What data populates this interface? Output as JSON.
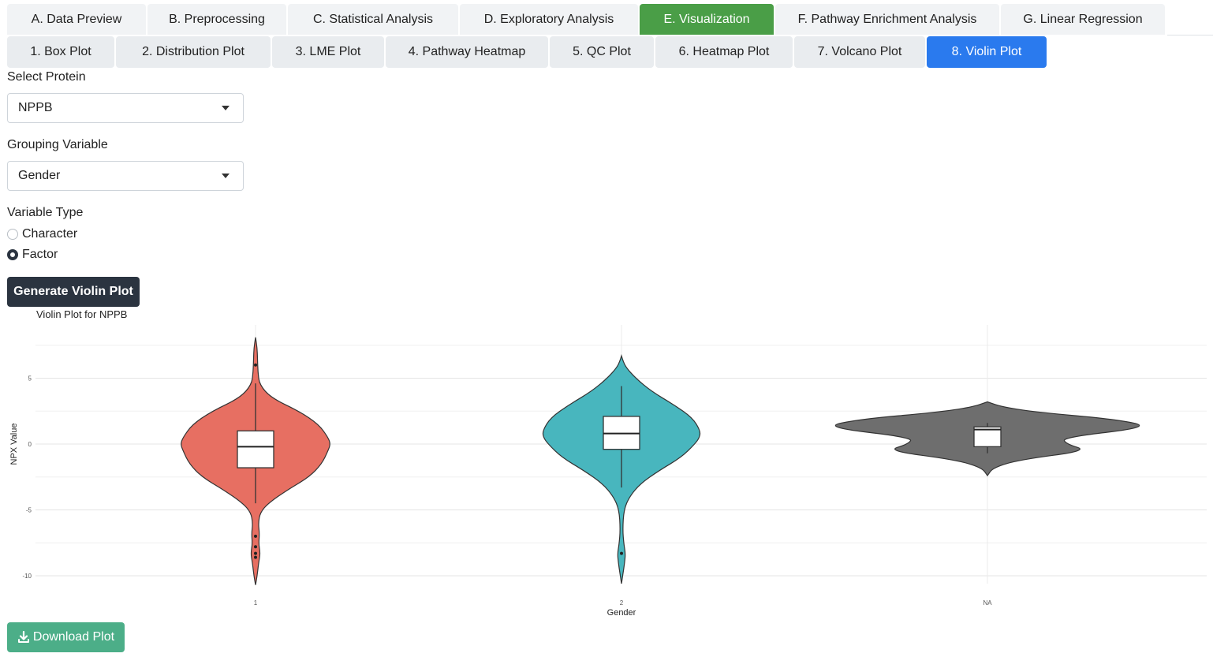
{
  "main_tabs": [
    {
      "label": "A. Data Preview",
      "active": false
    },
    {
      "label": "B. Preprocessing",
      "active": false
    },
    {
      "label": "C. Statistical Analysis",
      "active": false
    },
    {
      "label": "D. Exploratory Analysis",
      "active": false
    },
    {
      "label": "E. Visualization",
      "active": true
    },
    {
      "label": "F. Pathway Enrichment Analysis",
      "active": false
    },
    {
      "label": "G. Linear Regression",
      "active": false
    }
  ],
  "sub_tabs": [
    {
      "label": "1. Box Plot",
      "active": false
    },
    {
      "label": "2. Distribution Plot",
      "active": false
    },
    {
      "label": "3. LME Plot",
      "active": false
    },
    {
      "label": "4. Pathway Heatmap",
      "active": false
    },
    {
      "label": "5. QC Plot",
      "active": false
    },
    {
      "label": "6. Heatmap Plot",
      "active": false
    },
    {
      "label": "7. Volcano Plot",
      "active": false
    },
    {
      "label": "8. Violin Plot",
      "active": true
    }
  ],
  "form": {
    "protein_label": "Select Protein",
    "protein_value": "NPPB",
    "grouping_label": "Grouping Variable",
    "grouping_value": "Gender",
    "vartype_label": "Variable Type",
    "vartype_options": [
      {
        "label": "Character",
        "checked": false
      },
      {
        "label": "Factor",
        "checked": true
      }
    ],
    "generate_button": "Generate Violin Plot",
    "download_button": "Download Plot"
  },
  "colors": {
    "accent_green": "#4a9e47",
    "accent_blue": "#2a7aee",
    "dark": "#2b3440",
    "download": "#4cae88"
  },
  "chart_data": {
    "type": "violin",
    "title": "Violin Plot for NPPB",
    "xlabel": "Gender",
    "ylabel": "NPX Value",
    "categories": [
      "1",
      "2",
      "NA"
    ],
    "yticks": [
      5,
      0,
      -5,
      -10
    ],
    "ytick_labels": [
      "5",
      "0",
      "-5",
      "-10"
    ],
    "ylim": [
      -10.7,
      8.5
    ],
    "grid": true,
    "groups": [
      {
        "name": "1",
        "color": "#e76f62",
        "range": [
          -10.7,
          8.1
        ],
        "q1": -1.8,
        "median": -0.2,
        "q3": 1.0,
        "whisker_low": -4.5,
        "whisker_high": 4.6,
        "outliers": [
          6.0,
          -7.0,
          -7.8,
          -8.3,
          -8.6
        ]
      },
      {
        "name": "2",
        "color": "#48b6be",
        "range": [
          -10.6,
          6.7
        ],
        "q1": -0.4,
        "median": 0.8,
        "q3": 2.1,
        "whisker_low": -3.3,
        "whisker_high": 4.4,
        "outliers": [
          -8.3
        ]
      },
      {
        "name": "NA",
        "color": "#6e6e6e",
        "range": [
          -2.4,
          3.2
        ],
        "q1": -0.2,
        "median": 1.1,
        "q3": 1.3,
        "whisker_low": -0.7,
        "whisker_high": 1.6,
        "outliers": []
      }
    ]
  }
}
